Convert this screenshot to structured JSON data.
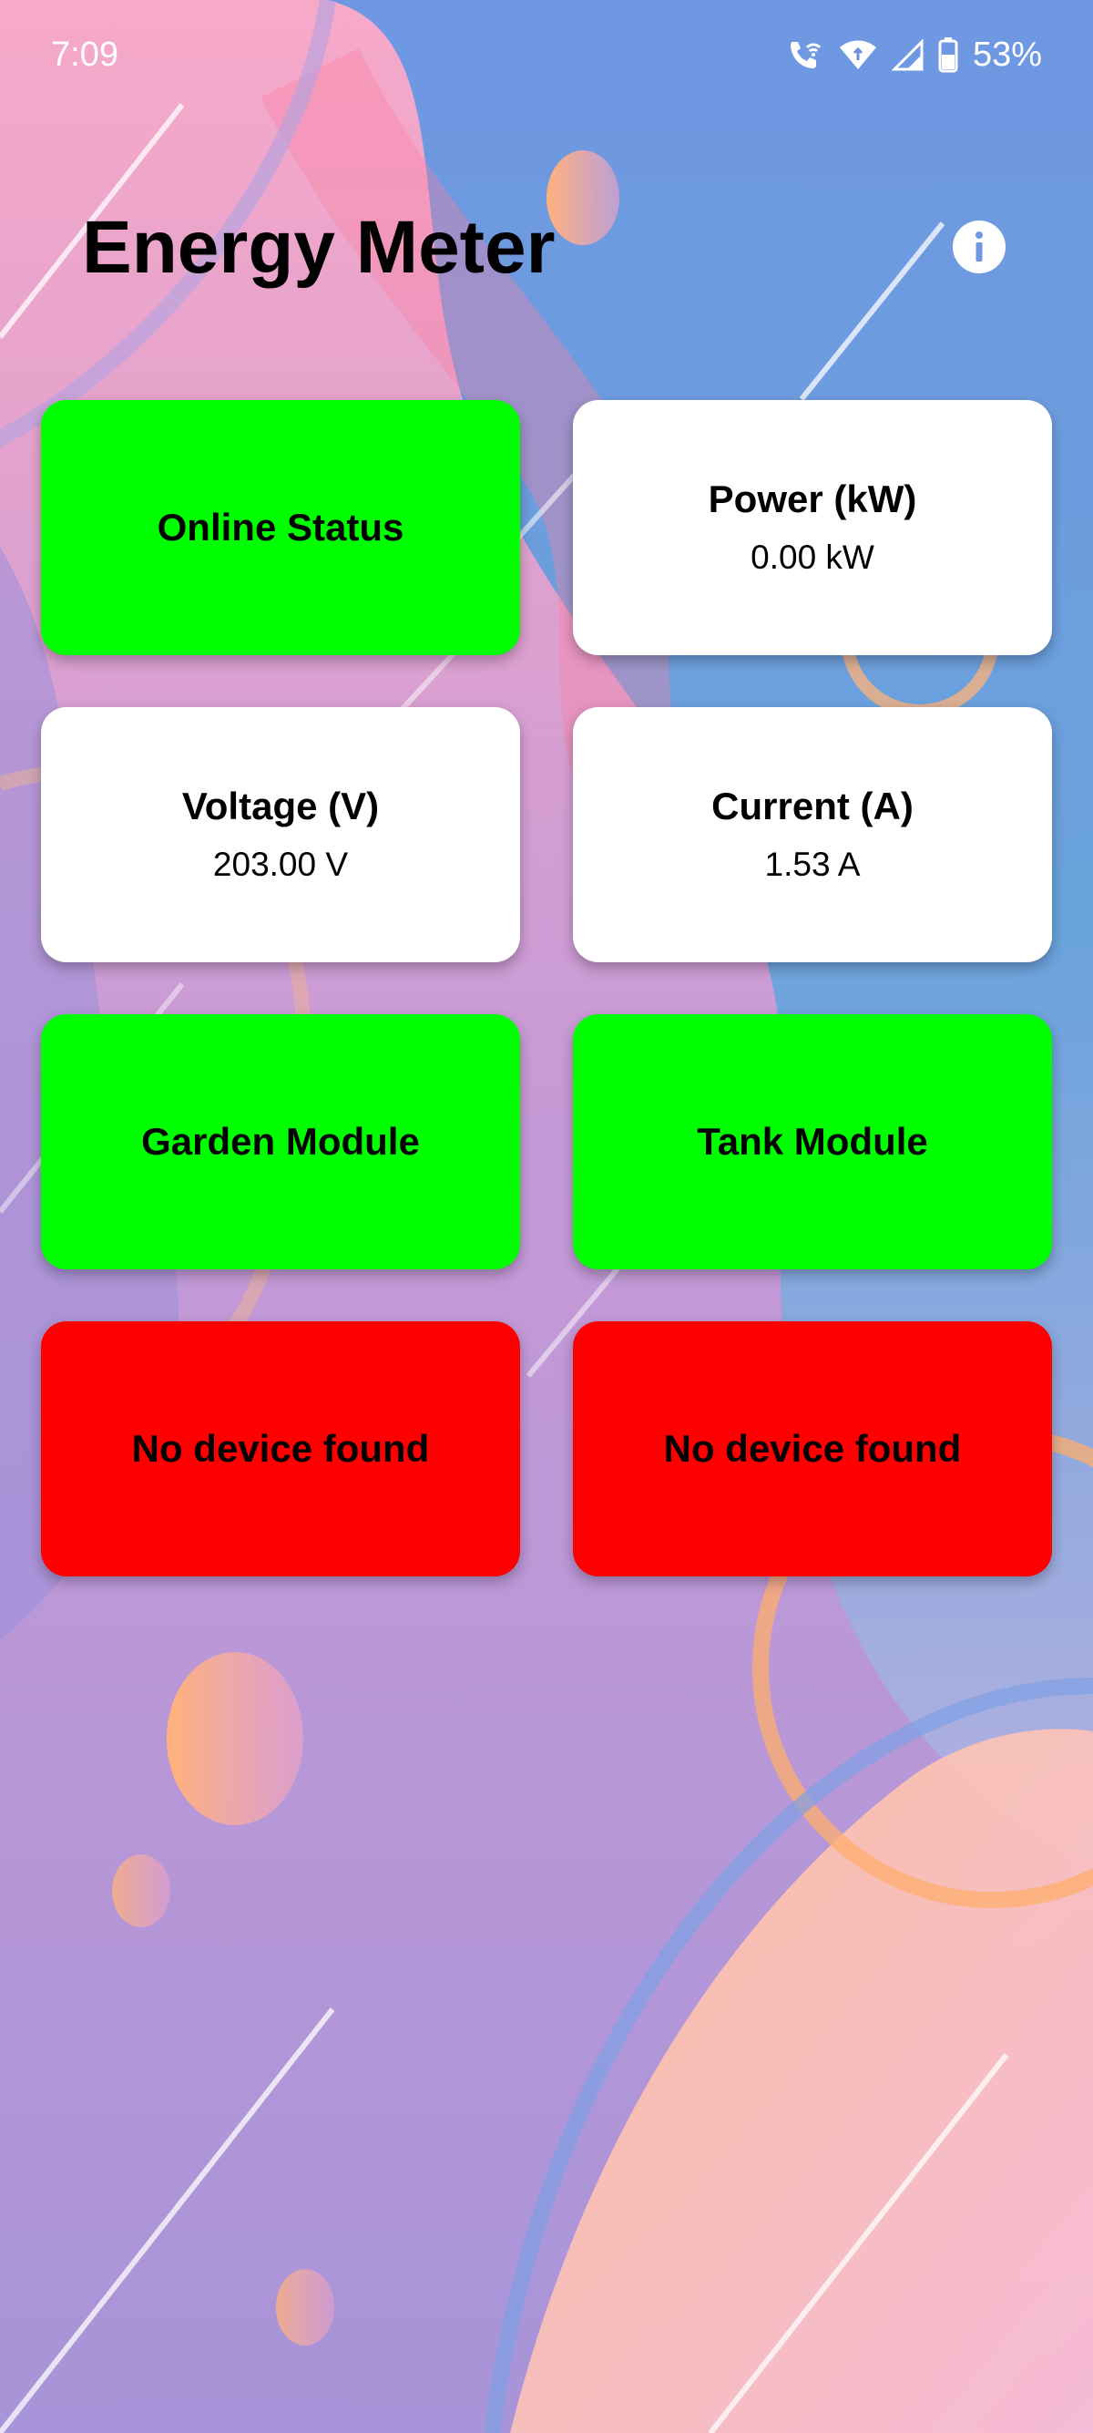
{
  "status_bar": {
    "time": "7:09",
    "battery": "53%",
    "icons": [
      "wifi-call-icon",
      "wifi-icon",
      "signal-icon",
      "battery-icon"
    ]
  },
  "header": {
    "title": "Energy Meter",
    "info_icon": "info-icon"
  },
  "colors": {
    "online": "#00ff00",
    "offline": "#ff0000",
    "neutral": "#ffffff"
  },
  "cards": [
    {
      "title": "Online Status",
      "value": null,
      "color": "#00ff00"
    },
    {
      "title": "Power (kW)",
      "value": "0.00 kW",
      "color": "#ffffff"
    },
    {
      "title": "Voltage (V)",
      "value": "203.00 V",
      "color": "#ffffff"
    },
    {
      "title": "Current (A)",
      "value": "1.53 A",
      "color": "#ffffff"
    },
    {
      "title": "Garden Module",
      "value": null,
      "color": "#00ff00"
    },
    {
      "title": "Tank Module",
      "value": null,
      "color": "#00ff00"
    },
    {
      "title": "No device found",
      "value": null,
      "color": "#ff0000"
    },
    {
      "title": "No device found",
      "value": null,
      "color": "#ff0000"
    }
  ]
}
